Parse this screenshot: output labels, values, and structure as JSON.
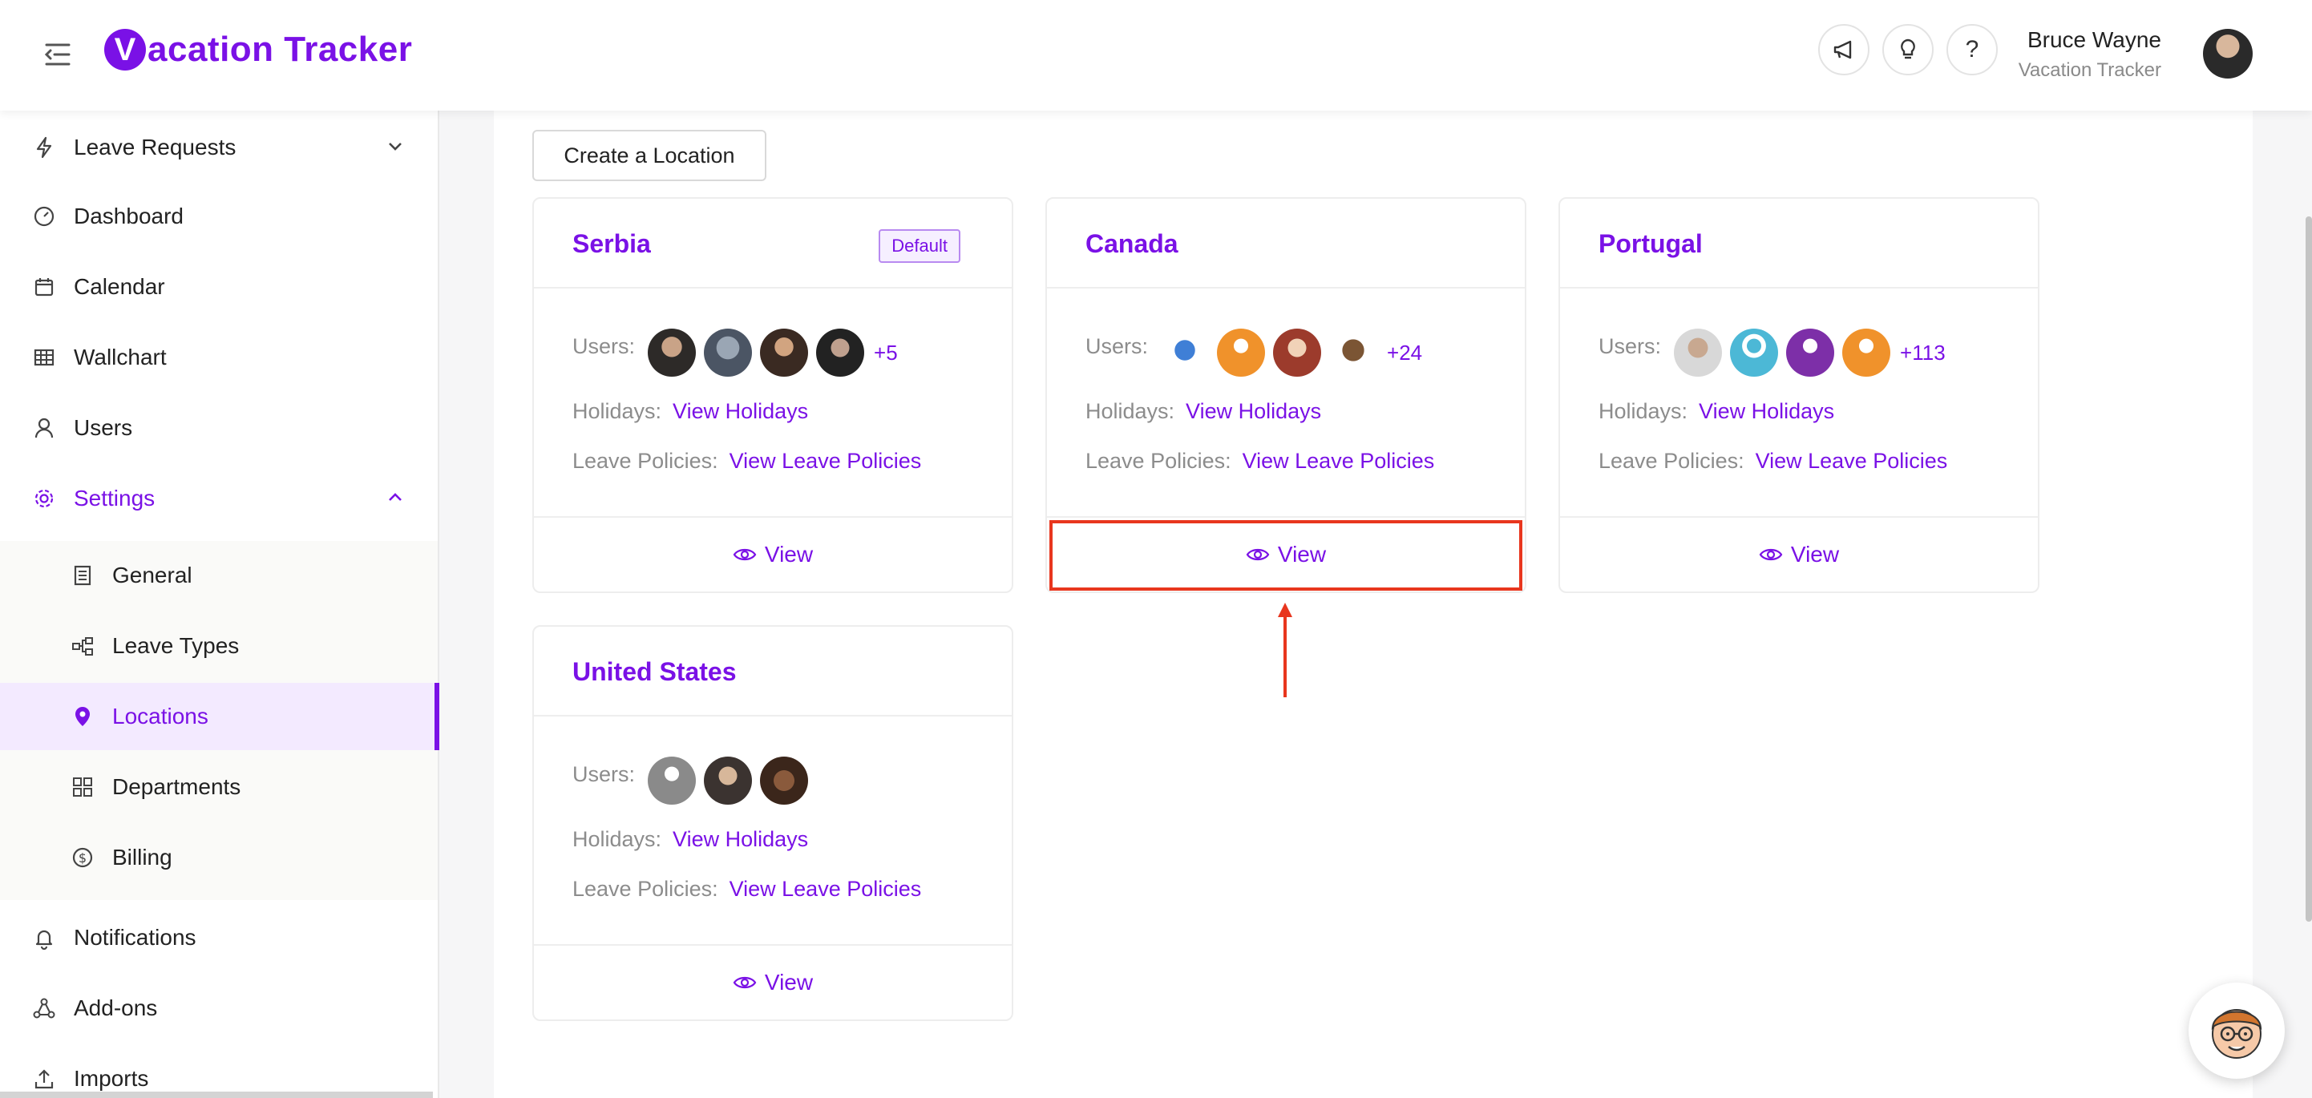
{
  "header": {
    "app_name": "acation Tracker",
    "logo_letter": "V",
    "user_name": "Bruce Wayne",
    "user_company": "Vacation Tracker",
    "buttons": [
      "megaphone-icon",
      "lightbulb-icon",
      "help-icon"
    ]
  },
  "sidebar": {
    "items": [
      {
        "label": "Leave Requests",
        "icon": "lightning-icon"
      },
      {
        "label": "Dashboard",
        "icon": "dashboard-icon"
      },
      {
        "label": "Calendar",
        "icon": "calendar-icon"
      },
      {
        "label": "Wallchart",
        "icon": "table-icon"
      },
      {
        "label": "Users",
        "icon": "user-icon"
      },
      {
        "label": "Settings",
        "icon": "gear-icon"
      },
      {
        "label": "Notifications",
        "icon": "bell-icon"
      },
      {
        "label": "Add-ons",
        "icon": "addons-icon"
      },
      {
        "label": "Imports",
        "icon": "upload-icon"
      }
    ],
    "settings_sub": [
      {
        "label": "General",
        "icon": "document-icon"
      },
      {
        "label": "Leave Types",
        "icon": "hierarchy-icon"
      },
      {
        "label": "Locations",
        "icon": "pin-icon"
      },
      {
        "label": "Departments",
        "icon": "grid-icon"
      },
      {
        "label": "Billing",
        "icon": "dollar-icon"
      }
    ]
  },
  "main": {
    "create_button": "Create a Location",
    "cards": [
      {
        "name": "Serbia",
        "badge": "Default",
        "users_label": "Users:",
        "more": "+5",
        "holidays_label": "Holidays:",
        "holidays_link": "View Holidays",
        "policies_label": "Leave Policies:",
        "policies_link": "View Leave Policies",
        "view": "View"
      },
      {
        "name": "Canada",
        "users_label": "Users:",
        "more": "+24",
        "holidays_label": "Holidays:",
        "holidays_link": "View Holidays",
        "policies_label": "Leave Policies:",
        "policies_link": "View Leave Policies",
        "view": "View"
      },
      {
        "name": "Portugal",
        "users_label": "Users:",
        "more": "+113",
        "holidays_label": "Holidays:",
        "holidays_link": "View Holidays",
        "policies_label": "Leave Policies:",
        "policies_link": "View Leave Policies",
        "view": "View"
      },
      {
        "name": "United States",
        "users_label": "Users:",
        "holidays_label": "Holidays:",
        "holidays_link": "View Holidays",
        "policies_label": "Leave Policies:",
        "policies_link": "View Leave Policies",
        "view": "View"
      }
    ]
  },
  "colors": {
    "accent": "#7a11e6",
    "highlight": "#e8361e"
  }
}
